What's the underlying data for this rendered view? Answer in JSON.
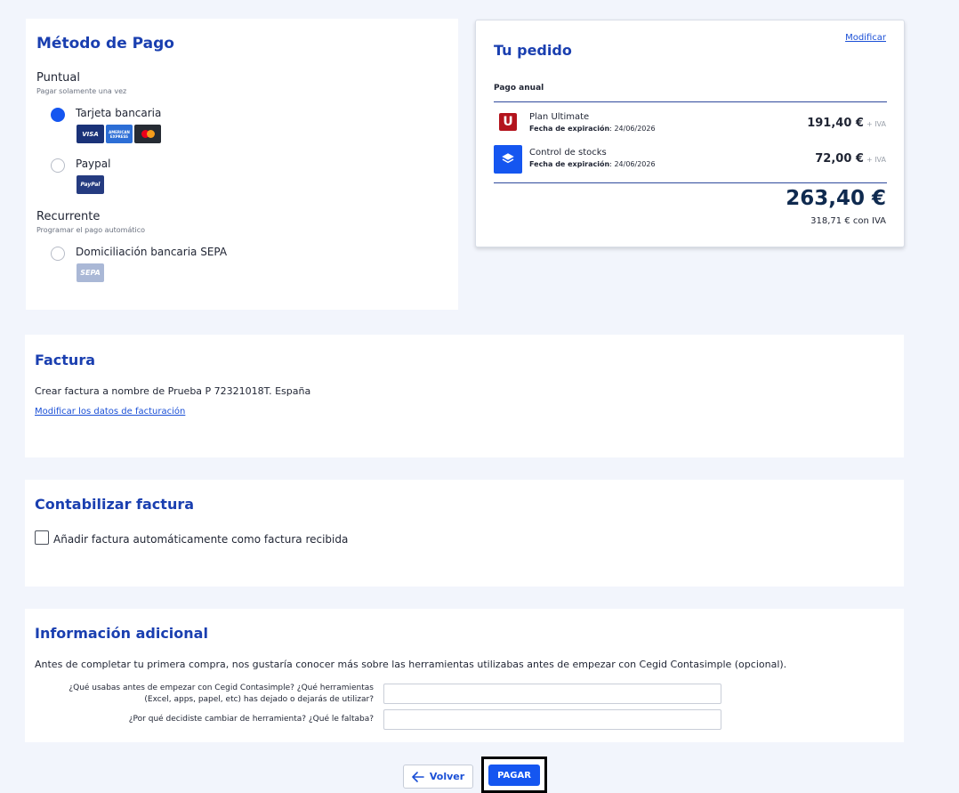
{
  "payment": {
    "title": "Método de Pago",
    "puntual_label": "Puntual",
    "puntual_sub": "Pagar solamente una vez",
    "card_label": "Tarjeta bancaria",
    "visa": "VISA",
    "amex": "AMERICAN EXPRESS",
    "paypal_label": "Paypal",
    "paypal_logo": "PayPal",
    "recurrente_label": "Recurrente",
    "recurrente_sub": "Programar el pago automático",
    "sepa_label": "Domiciliación bancaria SEPA",
    "sepa_logo": "SEPA"
  },
  "order": {
    "title": "Tu pedido",
    "modify": "Modificar",
    "frequency": "Pago anual",
    "products": [
      {
        "name": "Plan Ultimate",
        "exp_label": "Fecha de expiración",
        "exp_date": ": 24/06/2026",
        "price": "191,40 €",
        "iva": "+ IVA",
        "icon": "U"
      },
      {
        "name": "Control de stocks",
        "exp_label": "Fecha de expiración",
        "exp_date": ": 24/06/2026",
        "price": "72,00 €",
        "iva": "+ IVA",
        "icon": "layers-icon"
      }
    ],
    "total": "263,40 €",
    "total_iva": "318,71 € con IVA"
  },
  "invoice": {
    "title": "Factura",
    "text": "Crear factura a nombre de Prueba P 72321018T. España",
    "link": "Modificar los datos de facturación"
  },
  "accounting": {
    "title": "Contabilizar factura",
    "checkbox_label": "Añadir factura automáticamente como factura recibida"
  },
  "info": {
    "title": "Información adicional",
    "intro": "Antes de completar tu primera compra, nos gustaría conocer más sobre las herramientas utilizabas antes de empezar con Cegid Contasimple (opcional).",
    "q1_line1": "¿Qué usabas antes de empezar con Cegid Contasimple? ¿Qué herramientas",
    "q1_line2": "(Excel, apps, papel, etc) has dejado o dejarás de utilizar?",
    "q2": "¿Por qué decidiste cambiar de herramienta? ¿Qué le faltaba?",
    "q1_value": "",
    "q2_value": ""
  },
  "actions": {
    "back": "Volver",
    "pay": "PAGAR"
  },
  "colors": {
    "accent": "#1556f0",
    "title": "#1a3fb0",
    "background": "#f2f5fc"
  }
}
